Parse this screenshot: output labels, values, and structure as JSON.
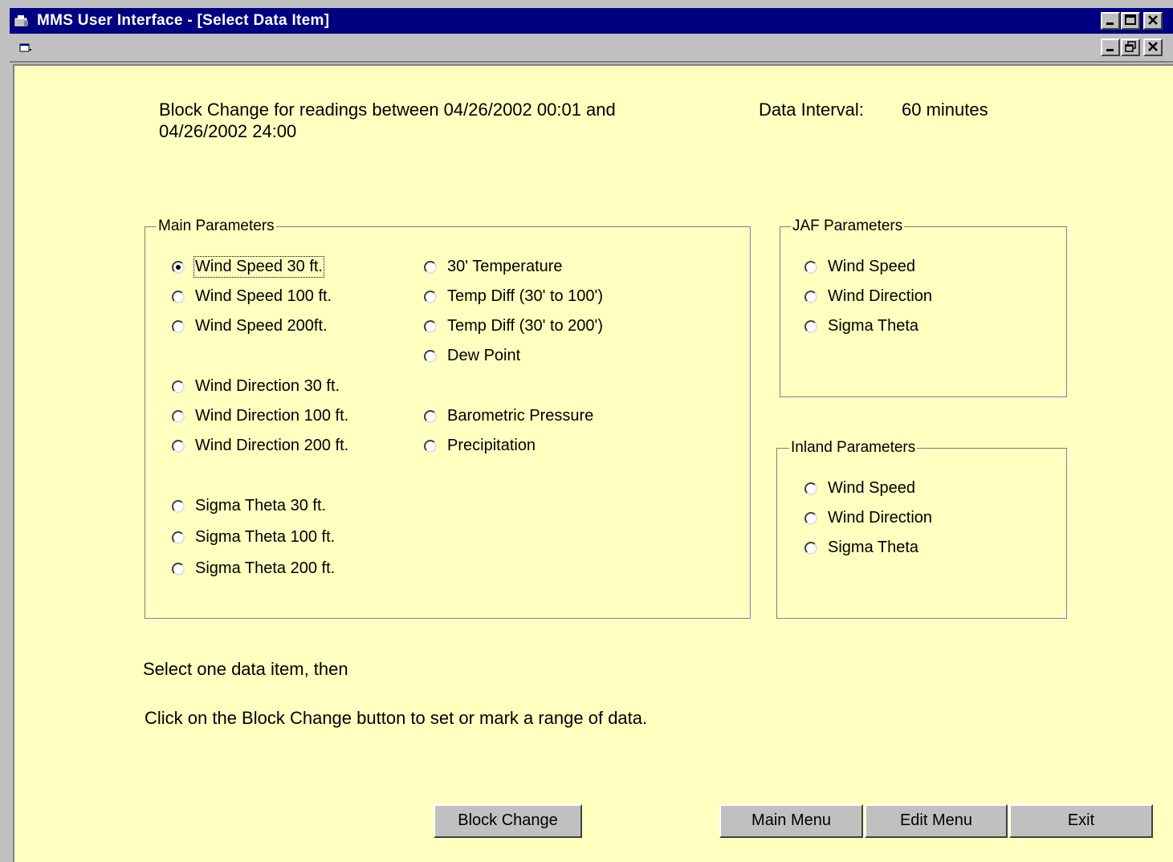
{
  "window": {
    "title": "MMS User Interface - [Select Data Item]"
  },
  "header": {
    "block_change_line1": "Block Change for readings between 04/26/2002 00:01 and",
    "block_change_line2": "04/26/2002 24:00",
    "interval_label": "Data Interval:",
    "interval_value": "60 minutes"
  },
  "main_group": {
    "legend": "Main Parameters",
    "col1": [
      "Wind Speed 30 ft.",
      "Wind Speed 100 ft.",
      "Wind Speed 200ft.",
      "Wind Direction 30 ft.",
      "Wind Direction 100 ft.",
      "Wind Direction 200 ft.",
      "Sigma Theta 30 ft.",
      "Sigma Theta 100 ft.",
      "Sigma Theta 200 ft."
    ],
    "col2": [
      "30' Temperature",
      "Temp Diff (30' to 100')",
      "Temp Diff (30' to 200')",
      "Dew Point",
      "Barometric Pressure",
      "Precipitation"
    ],
    "selected": "Wind Speed 30 ft."
  },
  "jaf_group": {
    "legend": "JAF Parameters",
    "items": [
      "Wind Speed",
      "Wind Direction",
      "Sigma Theta"
    ]
  },
  "inland_group": {
    "legend": "Inland Parameters",
    "items": [
      "Wind Speed",
      "Wind Direction",
      "Sigma Theta"
    ]
  },
  "instructions": {
    "line1": "Select one data item, then",
    "line2": "Click on the Block Change button to set or mark a range of data."
  },
  "buttons": {
    "block_change": "Block Change",
    "main_menu": "Main Menu",
    "edit_menu": "Edit Menu",
    "exit": "Exit"
  },
  "colors": {
    "title_bar": "#000080",
    "client_background": "#ffffc0",
    "button_face": "#c0c0c0"
  }
}
